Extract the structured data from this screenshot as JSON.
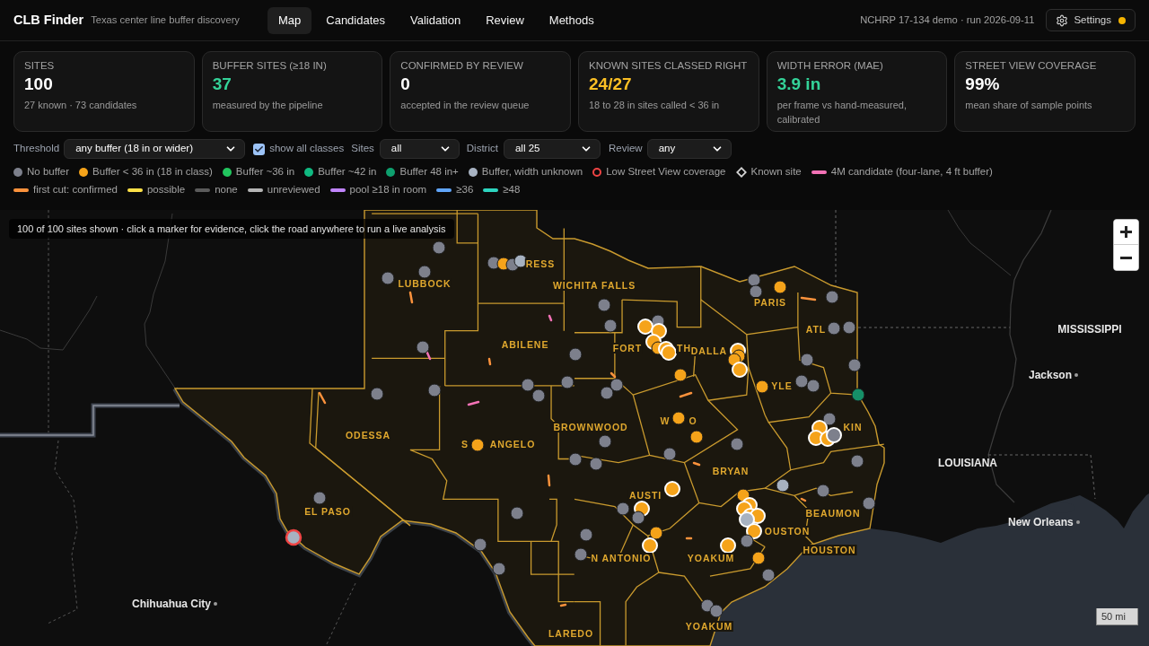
{
  "app": {
    "title": "CLB Finder",
    "subtitle": "Texas center line buffer discovery"
  },
  "nav": [
    {
      "label": "Map",
      "selected": true
    },
    {
      "label": "Candidates",
      "selected": false
    },
    {
      "label": "Validation",
      "selected": false
    },
    {
      "label": "Review",
      "selected": false
    },
    {
      "label": "Methods",
      "selected": false
    }
  ],
  "run_info": "NCHRP 17-134 demo · run 2026-09-11",
  "settings": {
    "label": "Settings",
    "status_dot": {
      "color": "#f5b400"
    }
  },
  "stats": [
    {
      "label": "SITES",
      "value": "100",
      "color": "#ffffff",
      "note": "27 known · 73 candidates"
    },
    {
      "label": "BUFFER SITES (≥18 IN)",
      "value": "37",
      "color": "#34d399",
      "note": "measured by the pipeline"
    },
    {
      "label": "CONFIRMED BY REVIEW",
      "value": "0",
      "color": "#ffffff",
      "note": "accepted in the review queue"
    },
    {
      "label": "KNOWN SITES CLASSED RIGHT",
      "value": "24/27",
      "color": "#fbbf24",
      "note": "18 to 28 in sites called < 36 in"
    },
    {
      "label": "WIDTH ERROR (MAE)",
      "value": "3.9 in",
      "color": "#34d399",
      "note": "per frame vs hand-measured, calibrated"
    },
    {
      "label": "STREET VIEW COVERAGE",
      "value": "99%",
      "color": "#ffffff",
      "note": "mean share of sample points"
    }
  ],
  "filters": {
    "threshold": {
      "label": "Threshold",
      "value": "any buffer (18 in or wider)"
    },
    "show_all_classes": {
      "label": "show all classes",
      "checked": true
    },
    "sites": {
      "label": "Sites",
      "value": "all"
    },
    "district": {
      "label": "District",
      "value": "all 25"
    },
    "review": {
      "label": "Review",
      "value": "any"
    }
  },
  "legend": [
    {
      "kind": "dot",
      "color": "#7d808c",
      "label": "No buffer"
    },
    {
      "kind": "dot",
      "color": "#f5a31a",
      "label": "Buffer < 36 in (18 in class)"
    },
    {
      "kind": "dot",
      "color": "#22c55e",
      "label": "Buffer ~36 in"
    },
    {
      "kind": "dot",
      "color": "#10b981",
      "label": "Buffer ~42 in"
    },
    {
      "kind": "dot",
      "color": "#0e9f6e",
      "label": "Buffer 48 in+"
    },
    {
      "kind": "dot",
      "color": "#a7b2c1",
      "label": "Buffer, width unknown"
    },
    {
      "kind": "ring",
      "color": "#ef4444",
      "label": "Low Street View coverage"
    },
    {
      "kind": "diamond",
      "color": "#d4d4d4",
      "label": "Known site"
    },
    {
      "kind": "line",
      "color": "#f472b6",
      "label": "4M candidate (four-lane, 4 ft buffer)"
    }
  ],
  "road_legend": [
    {
      "color": "#fb923c",
      "label": "first cut: confirmed"
    },
    {
      "color": "#fde047",
      "label": "possible"
    },
    {
      "color": "#5b5b5b",
      "label": "none"
    },
    {
      "color": "#b5b5b5",
      "label": "unreviewed"
    },
    {
      "color": "#c084fc",
      "label": "pool ≥18 in room"
    },
    {
      "color": "#60a5fa",
      "label": "≥36"
    },
    {
      "color": "#2dd4bf",
      "label": "≥48"
    }
  ],
  "map": {
    "hint": "100 of 100 sites shown · click a marker for evidence, click the road anywhere to run a live analysis",
    "scale": "50 mi",
    "place_labels": [
      {
        "kind": "region",
        "text": "MISSISSIPPI"
      },
      {
        "kind": "city",
        "text": "Jackson"
      },
      {
        "kind": "region",
        "text": "LOUISIANA"
      },
      {
        "kind": "city",
        "text": "New Orleans"
      },
      {
        "kind": "city",
        "text": "Chihuahua City"
      }
    ],
    "district_labels": [
      "RESS",
      "LUBBOCK",
      "WICHITA FALLS",
      "PARIS",
      "ATL",
      "ABILENE",
      "FORT",
      "TH",
      "DALLA",
      "YLE",
      "W",
      "O",
      "BROWNWOOD",
      "KIN",
      "ODESSA",
      "S",
      "ANGELO",
      "BRYAN",
      "AUSTI",
      "EL PASO",
      "BEAUMON",
      "OUSTON",
      "HOUSTON",
      "N ANTONIO",
      "YOAKUM",
      "YOAKUM",
      "LAREDO"
    ],
    "sites": [
      {
        "kind": "none",
        "known": false,
        "low_coverage": false
      },
      {
        "kind": "none",
        "known": false,
        "low_coverage": false
      },
      {
        "kind": "none",
        "known": false,
        "low_coverage": false
      },
      {
        "kind": "none",
        "known": false,
        "low_coverage": false
      },
      {
        "kind": "under_36",
        "known": false,
        "low_coverage": false
      },
      {
        "kind": "none",
        "known": false,
        "low_coverage": false
      },
      {
        "kind": "unknown",
        "known": false,
        "low_coverage": false
      },
      {
        "kind": "none",
        "known": false,
        "low_coverage": false
      },
      {
        "kind": "none",
        "known": false,
        "low_coverage": false
      },
      {
        "kind": "none",
        "known": false,
        "low_coverage": false
      },
      {
        "kind": "none",
        "known": false,
        "low_coverage": false
      },
      {
        "kind": "none",
        "known": false,
        "low_coverage": false
      },
      {
        "kind": "none",
        "known": false,
        "low_coverage": false
      },
      {
        "kind": "none",
        "known": false,
        "low_coverage": false
      },
      {
        "kind": "under_36",
        "known": false,
        "low_coverage": false
      },
      {
        "kind": "none",
        "known": false,
        "low_coverage": false
      },
      {
        "kind": "none",
        "known": false,
        "low_coverage": false
      },
      {
        "kind": "none",
        "known": false,
        "low_coverage": false
      },
      {
        "kind": "none",
        "known": false,
        "low_coverage": false
      },
      {
        "kind": "unknown",
        "known": false,
        "low_coverage": true
      },
      {
        "kind": "none",
        "known": false,
        "low_coverage": false
      },
      {
        "kind": "none",
        "known": false,
        "low_coverage": false
      },
      {
        "kind": "none",
        "known": false,
        "low_coverage": false
      },
      {
        "kind": "none",
        "known": false,
        "low_coverage": false
      },
      {
        "kind": "under_36",
        "known": true,
        "low_coverage": false
      },
      {
        "kind": "under_36",
        "known": true,
        "low_coverage": false
      },
      {
        "kind": "under_36",
        "known": true,
        "low_coverage": false
      },
      {
        "kind": "under_36",
        "known": false,
        "low_coverage": false
      },
      {
        "kind": "under_36",
        "known": true,
        "low_coverage": false
      },
      {
        "kind": "under_36",
        "known": true,
        "low_coverage": false
      },
      {
        "kind": "under_36",
        "known": false,
        "low_coverage": false
      },
      {
        "kind": "none",
        "known": false,
        "low_coverage": false
      },
      {
        "kind": "none",
        "known": false,
        "low_coverage": false
      },
      {
        "kind": "none",
        "known": false,
        "low_coverage": false
      },
      {
        "kind": "none",
        "known": false,
        "low_coverage": false
      },
      {
        "kind": "under_36",
        "known": false,
        "low_coverage": false
      },
      {
        "kind": "none",
        "known": false,
        "low_coverage": false
      },
      {
        "kind": "none",
        "known": false,
        "low_coverage": false
      },
      {
        "kind": "none",
        "known": false,
        "low_coverage": false
      },
      {
        "kind": "under_36",
        "known": true,
        "low_coverage": false
      },
      {
        "kind": "under_36",
        "known": false,
        "low_coverage": false
      },
      {
        "kind": "under_36",
        "known": false,
        "low_coverage": false
      },
      {
        "kind": "under_36",
        "known": true,
        "low_coverage": false
      },
      {
        "kind": "none",
        "known": false,
        "low_coverage": false
      },
      {
        "kind": "none",
        "known": false,
        "low_coverage": false
      },
      {
        "kind": "under_36",
        "known": false,
        "low_coverage": false
      },
      {
        "kind": "none",
        "known": false,
        "low_coverage": false
      },
      {
        "kind": "none",
        "known": false,
        "low_coverage": false
      },
      {
        "kind": "width_48_plus",
        "known": false,
        "low_coverage": false
      },
      {
        "kind": "none",
        "known": false,
        "low_coverage": false
      },
      {
        "kind": "under_36",
        "known": true,
        "low_coverage": false
      },
      {
        "kind": "under_36",
        "known": true,
        "low_coverage": false
      },
      {
        "kind": "under_36",
        "known": true,
        "low_coverage": false
      },
      {
        "kind": "none",
        "known": true,
        "low_coverage": false
      },
      {
        "kind": "under_36",
        "known": false,
        "low_coverage": false
      },
      {
        "kind": "under_36",
        "known": false,
        "low_coverage": false
      },
      {
        "kind": "none",
        "known": false,
        "low_coverage": false
      },
      {
        "kind": "none",
        "known": false,
        "low_coverage": false
      },
      {
        "kind": "none",
        "known": false,
        "low_coverage": false
      },
      {
        "kind": "none",
        "known": false,
        "low_coverage": false
      },
      {
        "kind": "none",
        "known": false,
        "low_coverage": false
      },
      {
        "kind": "unknown",
        "known": false,
        "low_coverage": false
      },
      {
        "kind": "none",
        "known": false,
        "low_coverage": false
      },
      {
        "kind": "under_36",
        "known": true,
        "low_coverage": false
      },
      {
        "kind": "under_36",
        "known": false,
        "low_coverage": false
      },
      {
        "kind": "under_36",
        "known": true,
        "low_coverage": false
      },
      {
        "kind": "under_36",
        "known": true,
        "low_coverage": false
      },
      {
        "kind": "under_36",
        "known": true,
        "low_coverage": false
      },
      {
        "kind": "under_36",
        "known": true,
        "low_coverage": false
      },
      {
        "kind": "unknown",
        "known": true,
        "low_coverage": false
      },
      {
        "kind": "none",
        "known": false,
        "low_coverage": false
      },
      {
        "kind": "under_36",
        "known": true,
        "low_coverage": false
      },
      {
        "kind": "none",
        "known": false,
        "low_coverage": false
      },
      {
        "kind": "none",
        "known": false,
        "low_coverage": false
      },
      {
        "kind": "under_36",
        "known": false,
        "low_coverage": false
      },
      {
        "kind": "under_36",
        "known": true,
        "low_coverage": false
      },
      {
        "kind": "none",
        "known": false,
        "low_coverage": false
      },
      {
        "kind": "none",
        "known": false,
        "low_coverage": false
      },
      {
        "kind": "under_36",
        "known": true,
        "low_coverage": false
      },
      {
        "kind": "none",
        "known": false,
        "low_coverage": false
      },
      {
        "kind": "under_36",
        "known": true,
        "low_coverage": false
      },
      {
        "kind": "under_36",
        "known": false,
        "low_coverage": false
      },
      {
        "kind": "none",
        "known": false,
        "low_coverage": false
      },
      {
        "kind": "none",
        "known": false,
        "low_coverage": false
      },
      {
        "kind": "none",
        "known": false,
        "low_coverage": false
      }
    ]
  }
}
